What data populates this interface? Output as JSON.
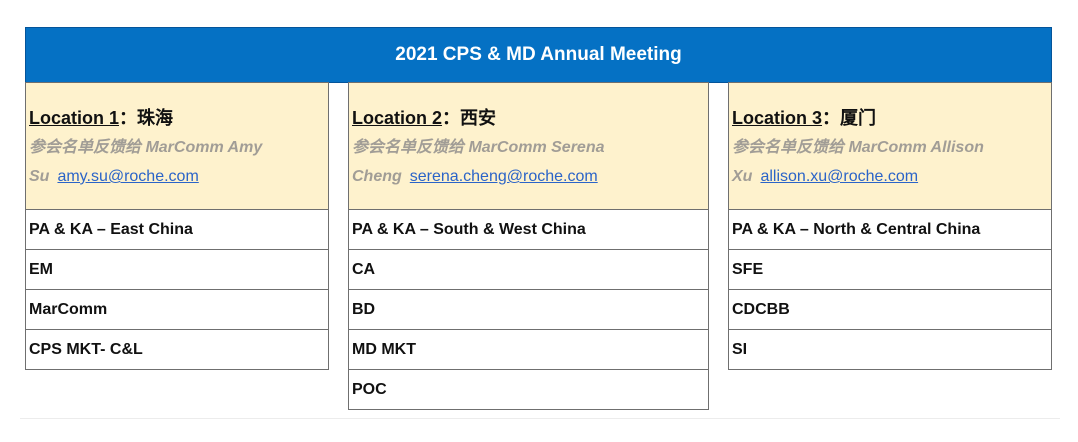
{
  "banner": {
    "title": "2021 CPS & MD Annual Meeting"
  },
  "locations": [
    {
      "label": "Location 1",
      "separator": "：",
      "city": "珠海",
      "contact_line1": "参会名单反馈给 MarComm Amy",
      "contact_line2": "Su",
      "email": "amy.su@roche.com",
      "teams": [
        "PA & KA – East China",
        "EM",
        "MarComm",
        "CPS MKT- C&L"
      ]
    },
    {
      "label": "Location 2",
      "separator": "：",
      "city": "西安",
      "contact_line1": "参会名单反馈给 MarComm Serena",
      "contact_line2": "Cheng",
      "email": "serena.cheng@roche.com",
      "teams": [
        "PA & KA – South & West China",
        "CA",
        "BD",
        "MD MKT",
        "POC"
      ]
    },
    {
      "label": "Location 3",
      "separator": "：",
      "city": "厦门",
      "contact_line1": "参会名单反馈给 MarComm Allison",
      "contact_line2": "Xu",
      "email": "allison.xu@roche.com",
      "teams": [
        "PA & KA – North & Central China",
        "SFE",
        "CDCBB",
        "SI"
      ]
    }
  ],
  "colors": {
    "banner_bg": "#0571c4",
    "header_bg": "#fef2cd",
    "contact_text": "#a19d96",
    "link": "#2b64c8"
  }
}
